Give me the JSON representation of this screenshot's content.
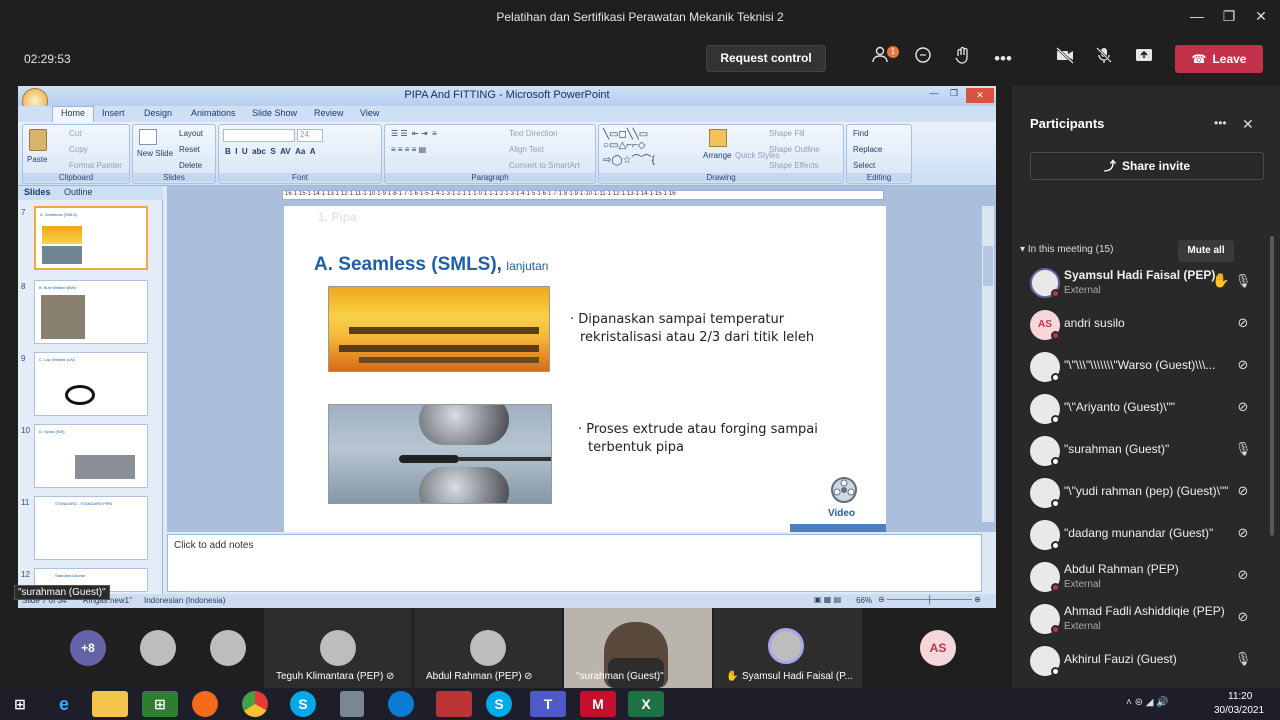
{
  "window": {
    "title": "Pelatihan dan Sertifikasi Perawatan Mekanik Teknisi 2"
  },
  "meeting": {
    "timer": "02:29:53",
    "request_control": "Request control",
    "leave": "Leave",
    "participants_badge": "1",
    "icons": [
      "people-icon",
      "chat-icon",
      "reactions-icon",
      "more-icon",
      "camera-off-icon",
      "mic-off-icon",
      "share-icon"
    ]
  },
  "ppt": {
    "title": "PIPA And FITTING - Microsoft PowerPoint",
    "tabs": [
      "Home",
      "Insert",
      "Design",
      "Animations",
      "Slide Show",
      "Review",
      "View"
    ],
    "clipboard": {
      "paste": "Paste",
      "cut": "Cut",
      "copy": "Copy",
      "format_painter": "Format Painter",
      "label": "Clipboard"
    },
    "slides_group": {
      "new_slide": "New Slide",
      "layout": "Layout",
      "reset": "Reset",
      "delete": "Delete",
      "label": "Slides"
    },
    "font_group": {
      "size": "24",
      "label": "Font"
    },
    "paragraph_group": {
      "text_direction": "Text Direction",
      "align_text": "Align Text",
      "convert": "Convert to SmartArt",
      "label": "Paragraph"
    },
    "drawing_group": {
      "arrange": "Arrange",
      "quick_styles": "Quick Styles",
      "shape_fill": "Shape Fill",
      "shape_outline": "Shape Outline",
      "shape_effects": "Shape Effects",
      "label": "Drawing"
    },
    "editing_group": {
      "find": "Find",
      "replace": "Replace",
      "select": "Select",
      "label": "Editing"
    },
    "pane_tabs": [
      "Slides",
      "Outline"
    ],
    "thumbnails": [
      {
        "num": "7",
        "title": "A. Seamless (SMLS)"
      },
      {
        "num": "8",
        "title": "B. Butt Welded (BW)"
      },
      {
        "num": "9",
        "title": "C. Lap Welded (LW)"
      },
      {
        "num": "10",
        "title": "D. Spiral (SW)"
      },
      {
        "num": "11",
        "title": "STANDARD - STANDARD PIPA"
      },
      {
        "num": "12",
        "title": "Standard Ukuran"
      }
    ],
    "ruler": "·16·1·15·1·14·1·13·1·12·1·11·1·10·1·9·1·8·1·7·1·6·1·5·1·4·1·3·1·2·1·1·1·0·1·1·1·2·1·3·1·4·1·5·1·6·1·7·1·8·1·9·1·10·1·11·1·12·1·13·1·14·1·15·1·16·",
    "slide": {
      "header": "1.  Pipa",
      "heading": "A. Seamless (SMLS),",
      "subheading": "lanjutan",
      "bullet1_line1": "· Dipanaskan sampai  temperatur",
      "bullet1_line2": "rekristalisasi atau 2/3 dari titik leleh",
      "bullet2_line1": "· Proses extrude atau forging sampai",
      "bullet2_line2": "terbentuk pipa",
      "video_label": "Video"
    },
    "notes_placeholder": "Click to add notes",
    "status": {
      "slide": "Slide 7 of 34",
      "theme": "\"Ringas new1\"",
      "language": "Indonesian (Indonesia)",
      "zoom": "66%"
    }
  },
  "participants": {
    "title": "Participants",
    "share_invite": "Share invite",
    "in_meeting": "In this meeting (15)",
    "mute_all": "Mute all",
    "list": [
      {
        "name": "Syamsul Hadi Faisal (PEP)",
        "sub": "External",
        "initials": "",
        "hand": true,
        "mic": "on"
      },
      {
        "name": "andri susilo",
        "sub": "",
        "initials": "AS",
        "hand": false,
        "mic": "off"
      },
      {
        "name": "\"\\\"\\\\\\\"\\\\\\\\\\\\\\\"Warso (Guest)\\\\\\...",
        "sub": "",
        "initials": "",
        "hand": false,
        "mic": "off"
      },
      {
        "name": "\"\\\"Ariyanto (Guest)\\\"\"",
        "sub": "",
        "initials": "",
        "hand": false,
        "mic": "off"
      },
      {
        "name": "\"surahman (Guest)\"",
        "sub": "",
        "initials": "",
        "hand": false,
        "mic": "on"
      },
      {
        "name": "\"\\\"yudi rahman (pep) (Guest)\\\"\"",
        "sub": "",
        "initials": "",
        "hand": false,
        "mic": "off"
      },
      {
        "name": "\"dadang munandar (Guest)\"",
        "sub": "",
        "initials": "",
        "hand": false,
        "mic": "off"
      },
      {
        "name": "Abdul Rahman (PEP)",
        "sub": "External",
        "initials": "",
        "hand": false,
        "mic": "off"
      },
      {
        "name": "Ahmad Fadli Ashiddiqie (PEP)",
        "sub": "External",
        "initials": "",
        "hand": false,
        "mic": "off"
      },
      {
        "name": "Akhirul Fauzi (Guest)",
        "sub": "",
        "initials": "",
        "hand": false,
        "mic": "on"
      }
    ]
  },
  "strip": {
    "overflow": "+8",
    "tiles": [
      {
        "label": "Teguh Klimantara (PEP)"
      },
      {
        "label": "Abdul Rahman (PEP)"
      },
      {
        "label": "\"surahman (Guest)\""
      },
      {
        "label": "Syamsul Hadi Faisal (P..."
      }
    ],
    "as_initials": "AS",
    "speaker_caption": "\"surahman (Guest)\""
  },
  "taskbar": {
    "time": "11:20",
    "date": "30/03/2021"
  },
  "colors": {
    "leave": "#c4314b",
    "accent": "#6264a7",
    "ppt_blue": "#1f5fa8"
  }
}
